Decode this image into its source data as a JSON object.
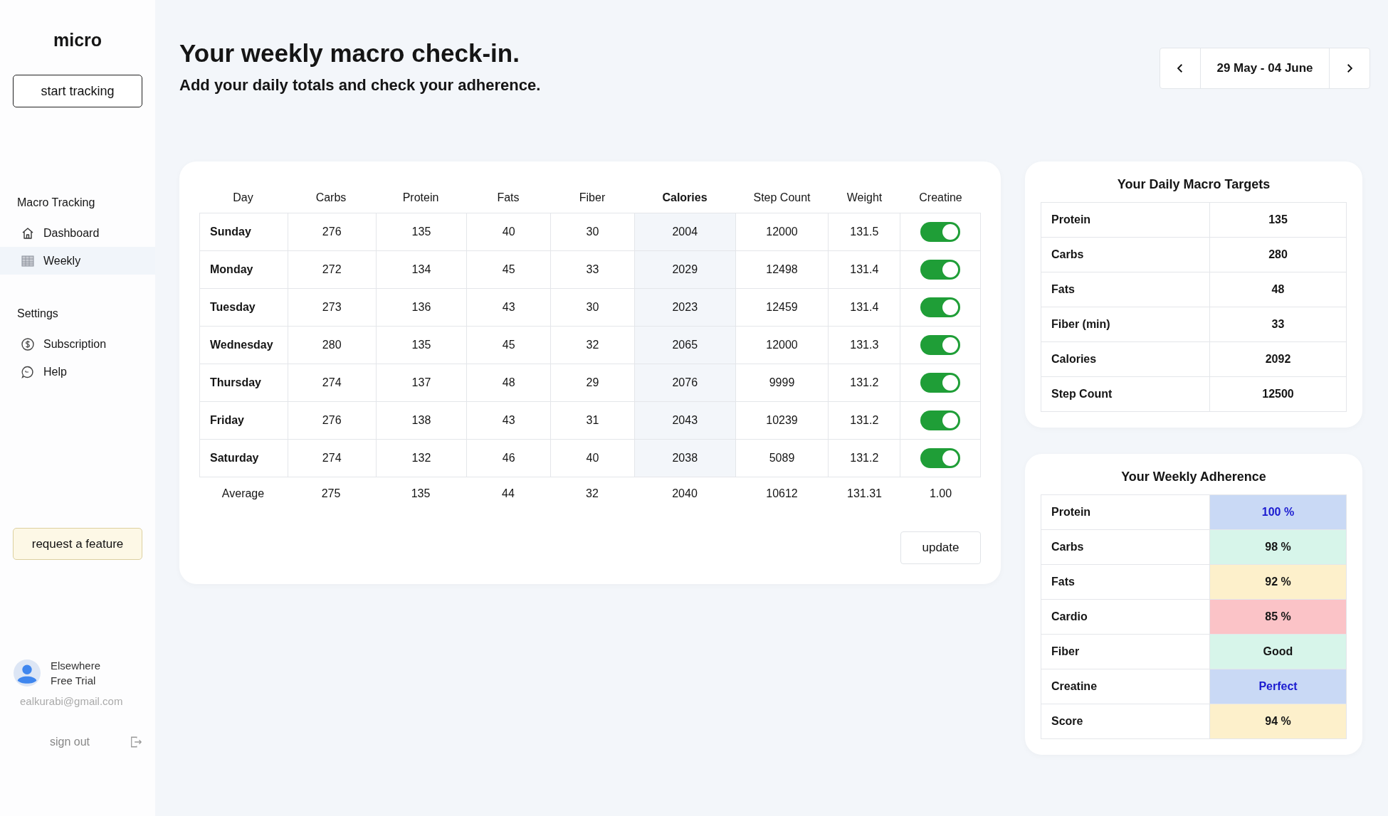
{
  "sidebar": {
    "logo": "micro",
    "start_button": "start tracking",
    "sections": [
      {
        "heading": "Macro Tracking",
        "items": [
          {
            "label": "Dashboard",
            "selected": false
          },
          {
            "label": "Weekly",
            "selected": true
          }
        ]
      },
      {
        "heading": "Settings",
        "items": [
          {
            "label": "Subscription",
            "selected": false
          },
          {
            "label": "Help",
            "selected": false
          }
        ]
      }
    ],
    "feature_button": "request a feature",
    "user": {
      "name": "Elsewhere",
      "plan": "Free Trial",
      "email": "ealkurabi@gmail.com"
    },
    "sign_out": "sign out"
  },
  "header": {
    "title": "Your weekly macro check-in.",
    "subtitle": "Add your daily totals and check your adherence.",
    "date_range": "29 May - 04 June"
  },
  "table": {
    "columns": [
      {
        "label": "Day",
        "highlighted": false
      },
      {
        "label": "Carbs",
        "highlighted": false
      },
      {
        "label": "Protein",
        "highlighted": false
      },
      {
        "label": "Fats",
        "highlighted": false
      },
      {
        "label": "Fiber",
        "highlighted": false
      },
      {
        "label": "Calories",
        "highlighted": true
      },
      {
        "label": "Step Count",
        "highlighted": false
      },
      {
        "label": "Weight",
        "highlighted": false
      },
      {
        "label": "Creatine",
        "highlighted": false
      }
    ],
    "rows": [
      {
        "cells": [
          "Sunday",
          "276",
          "135",
          "40",
          "30",
          "2004",
          "12000",
          "131.5"
        ],
        "creatine": true
      },
      {
        "cells": [
          "Monday",
          "272",
          "134",
          "45",
          "33",
          "2029",
          "12498",
          "131.4"
        ],
        "creatine": true
      },
      {
        "cells": [
          "Tuesday",
          "273",
          "136",
          "43",
          "30",
          "2023",
          "12459",
          "131.4"
        ],
        "creatine": true
      },
      {
        "cells": [
          "Wednesday",
          "280",
          "135",
          "45",
          "32",
          "2065",
          "12000",
          "131.3"
        ],
        "creatine": true
      },
      {
        "cells": [
          "Thursday",
          "274",
          "137",
          "48",
          "29",
          "2076",
          "9999",
          "131.2"
        ],
        "creatine": true
      },
      {
        "cells": [
          "Friday",
          "276",
          "138",
          "43",
          "31",
          "2043",
          "10239",
          "131.2"
        ],
        "creatine": true
      },
      {
        "cells": [
          "Saturday",
          "274",
          "132",
          "46",
          "40",
          "2038",
          "5089",
          "131.2"
        ],
        "creatine": true
      }
    ],
    "average": [
      "Average",
      "275",
      "135",
      "44",
      "32",
      "2040",
      "10612",
      "131.31",
      "1.00"
    ],
    "update_button": "update"
  },
  "targets": {
    "title": "Your Daily Macro Targets",
    "rows": [
      {
        "label": "Protein",
        "value": "135"
      },
      {
        "label": "Carbs",
        "value": "280"
      },
      {
        "label": "Fats",
        "value": "48"
      },
      {
        "label": "Fiber (min)",
        "value": "33"
      },
      {
        "label": "Calories",
        "value": "2092"
      },
      {
        "label": "Step Count",
        "value": "12500"
      }
    ]
  },
  "adherence": {
    "title": "Your Weekly Adherence",
    "rows": [
      {
        "label": "Protein",
        "value": "100 %",
        "color": "#c9d9f5"
      },
      {
        "label": "Carbs",
        "value": "98 %",
        "color": "#d7f5ea"
      },
      {
        "label": "Fats",
        "value": "92 %",
        "color": "#fdf0cb"
      },
      {
        "label": "Cardio",
        "value": "85 %",
        "color": "#fbc3c7"
      },
      {
        "label": "Fiber",
        "value": "Good",
        "color": "#d7f5ea"
      },
      {
        "label": "Creatine",
        "value": "Perfect",
        "color": "#c9d9f5"
      },
      {
        "label": "Score",
        "value": "94 %",
        "color": "#fdf0cb"
      }
    ]
  }
}
